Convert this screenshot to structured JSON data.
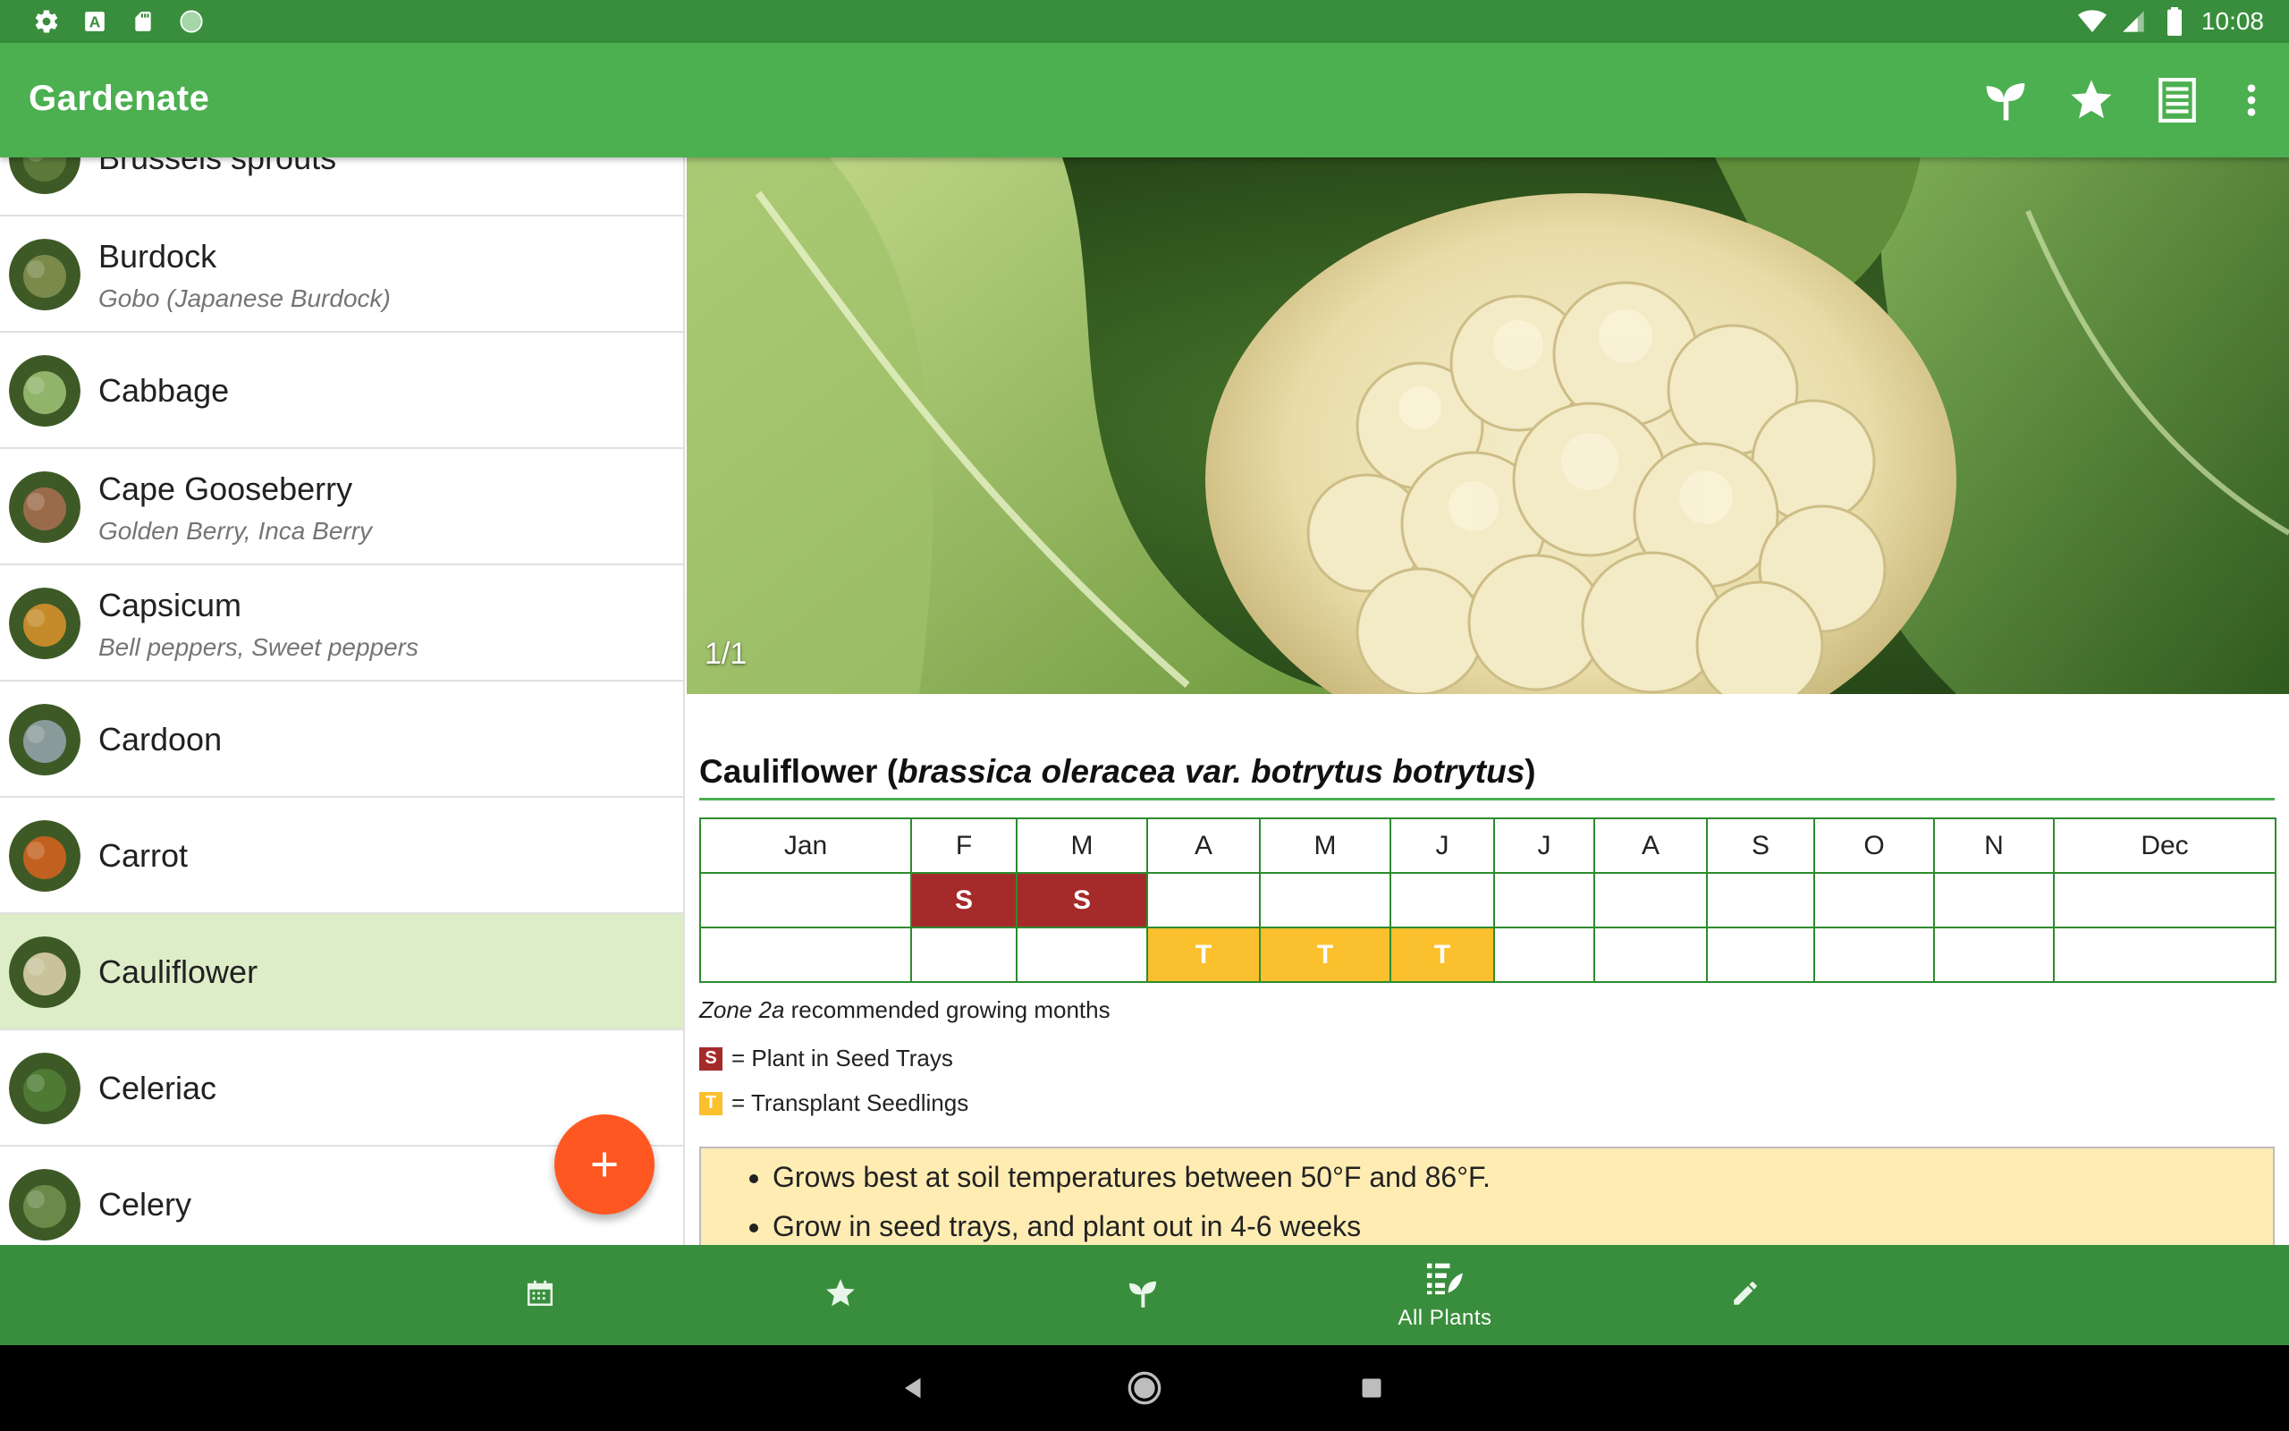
{
  "status_bar": {
    "time": "10:08",
    "left_icons": [
      "settings-icon",
      "a-icon",
      "sd-card-icon",
      "circle-icon"
    ],
    "right_icons": [
      "wifi-icon",
      "signal-icon",
      "battery-icon"
    ]
  },
  "app_bar": {
    "title": "Gardenate",
    "actions": [
      "sprout-icon",
      "star-icon",
      "list-icon",
      "more-vert-icon"
    ]
  },
  "plant_list": [
    {
      "name": "Brussels sprouts",
      "sub": "",
      "color": "#5d7a3a"
    },
    {
      "name": "Burdock",
      "sub": "Gobo (Japanese Burdock)",
      "color": "#7b8a4a"
    },
    {
      "name": "Cabbage",
      "sub": "",
      "color": "#8fb46a"
    },
    {
      "name": "Cape Gooseberry",
      "sub": "Golden Berry, Inca Berry",
      "color": "#9a6b4a"
    },
    {
      "name": "Capsicum",
      "sub": "Bell peppers, Sweet peppers",
      "color": "#c58a2a"
    },
    {
      "name": "Cardoon",
      "sub": "",
      "color": "#8a9a9a"
    },
    {
      "name": "Carrot",
      "sub": "",
      "color": "#c2611f"
    },
    {
      "name": "Cauliflower",
      "sub": "",
      "color": "#c9c29a",
      "selected": true
    },
    {
      "name": "Celeriac",
      "sub": "",
      "color": "#4e7a34"
    },
    {
      "name": "Celery",
      "sub": "",
      "color": "#6a8a4a"
    }
  ],
  "fab": {
    "icon": "add-icon"
  },
  "detail": {
    "photo_counter": "1/1",
    "common_name": "Cauliflower",
    "scientific_name": "brassica oleracea var. botrytus botrytus",
    "months": [
      "Jan",
      "F",
      "M",
      "A",
      "M",
      "J",
      "J",
      "A",
      "S",
      "O",
      "N",
      "Dec"
    ],
    "seed_row": [
      "",
      "S",
      "S",
      "",
      "",
      "",
      "",
      "",
      "",
      "",
      "",
      ""
    ],
    "transplant_row": [
      "",
      "",
      "",
      "T",
      "T",
      "T",
      "",
      "",
      "",
      "",
      "",
      ""
    ],
    "zone": "Zone 2a",
    "zone_suffix": "recommended growing months",
    "legend_seed_letter": "S",
    "legend_seed_text": "= Plant in Seed Trays",
    "legend_transplant_letter": "T",
    "legend_transplant_text": "= Transplant Seedlings",
    "notes": [
      "Grows best at soil temperatures between 50°F and 86°F.",
      "Grow in seed trays, and plant out in 4-6 weeks"
    ],
    "colors": {
      "seed": "#a52a2a",
      "transplant": "#fbc02d",
      "accent": "#4caf50"
    }
  },
  "bottom_nav": [
    {
      "icon": "calendar-icon",
      "label": ""
    },
    {
      "icon": "star-icon",
      "label": ""
    },
    {
      "icon": "sprout-icon",
      "label": ""
    },
    {
      "icon": "all-plants-icon",
      "label": "All Plants",
      "active": true
    },
    {
      "icon": "pencil-icon",
      "label": ""
    }
  ],
  "system_nav": [
    "back-icon",
    "home-icon",
    "recents-icon"
  ]
}
